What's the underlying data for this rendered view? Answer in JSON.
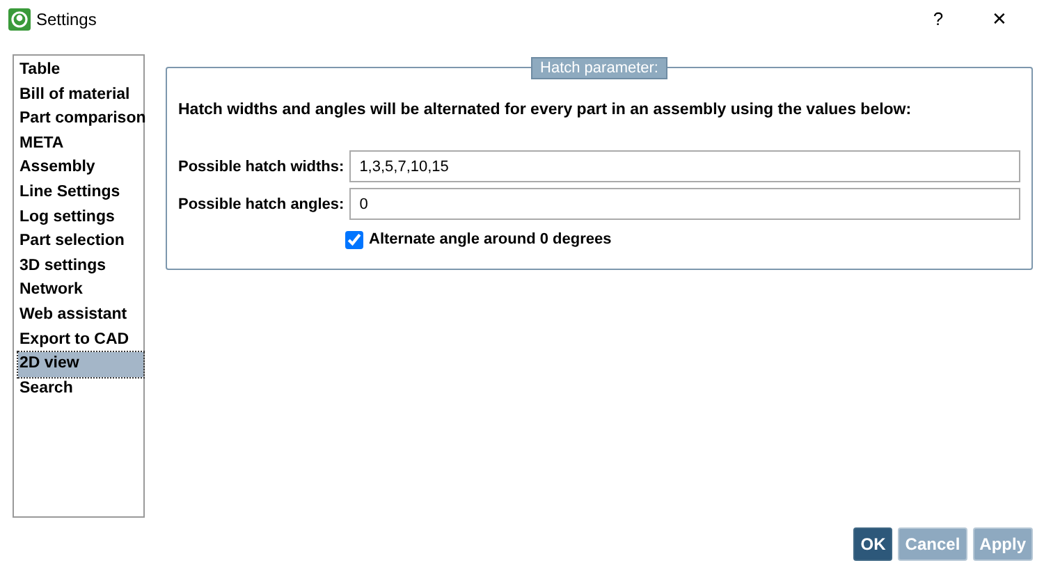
{
  "window": {
    "title": "Settings",
    "controls": [
      "?",
      "✕"
    ]
  },
  "sidebar": {
    "items": [
      {
        "label": "Table",
        "selected": false
      },
      {
        "label": "Bill of material",
        "selected": false
      },
      {
        "label": "Part comparison",
        "selected": false
      },
      {
        "label": "META",
        "selected": false
      },
      {
        "label": "Assembly",
        "selected": false
      },
      {
        "label": "Line Settings",
        "selected": false
      },
      {
        "label": "Log settings",
        "selected": false
      },
      {
        "label": "Part selection",
        "selected": false
      },
      {
        "label": "3D settings",
        "selected": false
      },
      {
        "label": "Network",
        "selected": false
      },
      {
        "label": "Web assistant",
        "selected": false
      },
      {
        "label": "Export to CAD",
        "selected": false
      },
      {
        "label": "2D view",
        "selected": true
      },
      {
        "label": "Search",
        "selected": false
      }
    ]
  },
  "panel": {
    "title": "Hatch parameter:",
    "description": "Hatch widths and angles will be alternated for every part in an assembly using the values below:",
    "fields": [
      {
        "label": "Possible hatch widths:",
        "value": "1,3,5,7,10,15"
      },
      {
        "label": "Possible hatch angles:",
        "value": "0"
      }
    ],
    "checkbox": {
      "label": "Alternate angle around 0 degrees",
      "checked": true
    }
  },
  "buttons": [
    {
      "label": "OK",
      "disabled": false
    },
    {
      "label": "Cancel",
      "disabled": true
    },
    {
      "label": "Apply",
      "disabled": true
    }
  ]
}
